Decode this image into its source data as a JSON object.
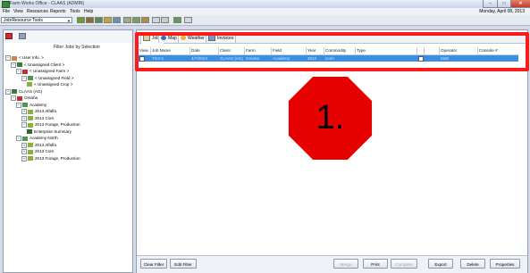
{
  "window": {
    "title": "Farm Works Office - CLAAS (ADMIN)",
    "date": "Monday, April 08, 2013"
  },
  "menu": [
    "File",
    "View",
    "Resources",
    "Reports",
    "Tools",
    "Help"
  ],
  "toolbar": {
    "select_value": "Job/Resource Tools"
  },
  "left": {
    "filter_label": "Filter Jobs by Selection",
    "tree": [
      {
        "label": "< User Info. >",
        "icon": "user-info-icon",
        "indent": 0,
        "exp": "−"
      },
      {
        "label": "< Unassigned Client >",
        "icon": "client-icon",
        "indent": 1,
        "exp": "−"
      },
      {
        "label": "< Unassigned Farm >",
        "icon": "farm-icon",
        "indent": 2,
        "exp": "−"
      },
      {
        "label": "< Unassigned Field >",
        "icon": "field-icon",
        "indent": 3,
        "exp": "−"
      },
      {
        "label": "< Unassigned Crop >",
        "icon": "crop-icon",
        "indent": 4,
        "exp": ""
      },
      {
        "label": "CLAAS (AG)",
        "icon": "client-icon",
        "indent": 0,
        "exp": "−"
      },
      {
        "label": "Omaha",
        "icon": "farm-icon",
        "indent": 1,
        "exp": "−"
      },
      {
        "label": "Academy",
        "icon": "field-icon",
        "indent": 2,
        "exp": "−"
      },
      {
        "label": "2013 Alfalfa",
        "icon": "crop-icon",
        "indent": 3,
        "exp": "+"
      },
      {
        "label": "2013 Corn",
        "icon": "crop-icon",
        "indent": 3,
        "exp": "+"
      },
      {
        "label": "2013 Forage, Production",
        "icon": "crop-icon",
        "indent": 3,
        "exp": "−"
      },
      {
        "label": "Enterprise Summary",
        "icon": "summary-icon",
        "indent": 4,
        "exp": ""
      },
      {
        "label": "Academy North",
        "icon": "field-icon",
        "indent": 2,
        "exp": "−"
      },
      {
        "label": "2013 Alfalfa",
        "icon": "crop-icon",
        "indent": 3,
        "exp": "+"
      },
      {
        "label": "2013 Corn",
        "icon": "crop-icon",
        "indent": 3,
        "exp": "+"
      },
      {
        "label": "2013 Forage, Production",
        "icon": "crop-icon",
        "indent": 3,
        "exp": "+"
      }
    ]
  },
  "tabs": [
    {
      "label": "Jobs",
      "icon": "jobs-icon"
    },
    {
      "label": "Map",
      "icon": "map-icon"
    },
    {
      "label": "Weather",
      "icon": "weather-icon"
    },
    {
      "label": "Invoices",
      "icon": "invoices-icon"
    }
  ],
  "grid": {
    "columns": [
      "View",
      "Job Name",
      "Date",
      "Client",
      "Farm",
      "Field",
      "Year",
      "Commodity",
      "Type",
      "",
      "",
      "Operator",
      "Console #"
    ],
    "row": [
      "",
      "TG3-1",
      "4/7/2013",
      "CLAAS (AG)",
      "Omaha",
      "Academy",
      "2013",
      "Corn",
      "",
      "",
      "",
      "Matt",
      ""
    ]
  },
  "annotation": {
    "label": "1.",
    "box_color": "#ff1a1a",
    "octagon_color": "#e60000"
  },
  "buttons": {
    "clear_filter": "Clear Filter",
    "edit_filter": "Edit Filter",
    "merge": "Merge",
    "print": "Print",
    "complete": "Complete",
    "export": "Export",
    "delete": "Delete",
    "properties": "Properties"
  },
  "colors": {
    "selection": "#3b8fe0",
    "title_bar": "#c9d6ea"
  }
}
